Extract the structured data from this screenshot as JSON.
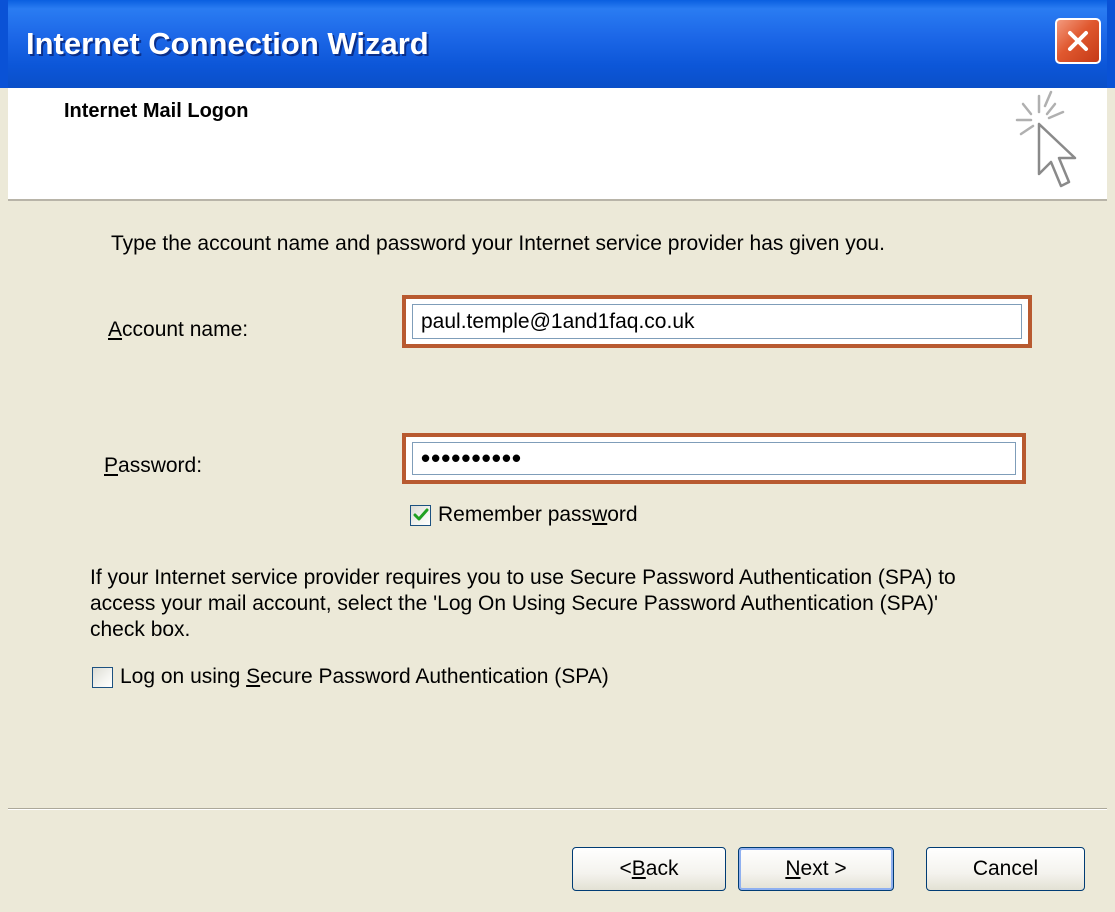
{
  "window": {
    "title": "Internet Connection Wizard"
  },
  "header": {
    "title": "Internet Mail Logon"
  },
  "instruction": "Type the account name and password your Internet service provider has given you.",
  "account": {
    "label_mnemonic": "A",
    "label_rest": "ccount name:",
    "value": "paul.temple@1and1faq.co.uk"
  },
  "password": {
    "label_mnemonic": "P",
    "label_rest": "assword:",
    "value": "••••••••••"
  },
  "remember": {
    "label_before": "Remember pass",
    "label_mnemonic": "w",
    "label_after": "ord",
    "checked": true
  },
  "spa": {
    "description": "If your Internet service provider requires you to use Secure Password Authentication (SPA) to access your mail account, select the 'Log On Using Secure Password Authentication (SPA)' check box.",
    "checkbox_before": "Log on using ",
    "checkbox_mnemonic": "S",
    "checkbox_after": "ecure Password Authentication (SPA)",
    "checked": false
  },
  "buttons": {
    "back_prefix": "< ",
    "back_mnemonic": "B",
    "back_rest": "ack",
    "next_mnemonic": "N",
    "next_rest": "ext >",
    "cancel": "Cancel"
  },
  "colors": {
    "highlight": "#b85a30",
    "titlebar": "#0c56d8",
    "face": "#ece9d8"
  }
}
